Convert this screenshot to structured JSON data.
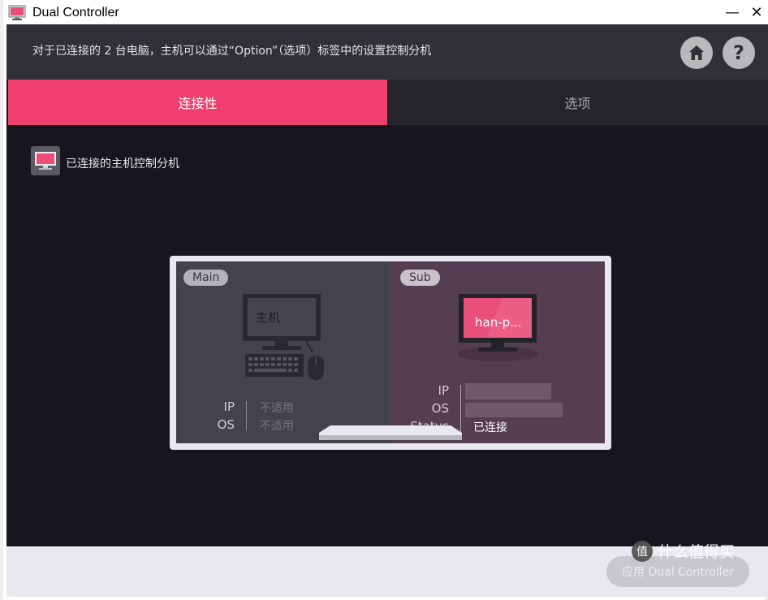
{
  "window": {
    "title": "Dual Controller",
    "minimize_glyph": "—",
    "close_glyph": "✕"
  },
  "header": {
    "description": "对于已连接的 2 台电脑，主机可以通过“Option”（选项）标签中的设置控制分机",
    "home_icon": "home-icon",
    "help_label": "?"
  },
  "tabs": [
    {
      "label": "连接性",
      "active": true
    },
    {
      "label": "选项",
      "active": false
    }
  ],
  "section": {
    "title": "已连接的主机控制分机"
  },
  "main_panel": {
    "badge": "Main",
    "pc_label": "主机",
    "rows": [
      {
        "label": "IP",
        "value": "不适用"
      },
      {
        "label": "OS",
        "value": "不适用"
      }
    ]
  },
  "sub_panel": {
    "badge": "Sub",
    "pc_label": "han-p...",
    "rows": [
      {
        "label": "IP",
        "value": ""
      },
      {
        "label": "OS",
        "value": ""
      },
      {
        "label": "Status",
        "value": "已连接"
      }
    ]
  },
  "footer": {
    "apply_label": "应用 Dual Controller"
  },
  "watermark": {
    "logo_glyph": "值",
    "text": "什么值得买"
  },
  "colors": {
    "accent": "#ef3f6e",
    "background": "#17151e",
    "header": "#303036",
    "main_panel": "#43424d",
    "sub_panel": "#563e52"
  }
}
